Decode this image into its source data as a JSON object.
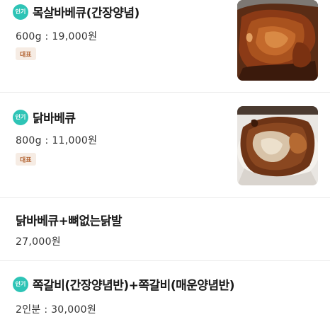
{
  "menu": {
    "items": [
      {
        "badge": "인기",
        "name": "목살바베큐(간장양념)",
        "price": "600g : 19,000원",
        "tag": "대표",
        "image": "grilled-pork-neck-photo"
      },
      {
        "badge": "인기",
        "name": "닭바베큐",
        "price": "800g : 11,000원",
        "tag": "대표",
        "image": "grilled-chicken-photo"
      },
      {
        "name": "닭바베큐+뼈없는닭발",
        "price": "27,000원"
      },
      {
        "badge": "인기",
        "name": "쪽갈비(간장양념반)+쪽갈비(매운양념반)",
        "price": "2인분 : 30,000원"
      }
    ]
  },
  "colors": {
    "popular_badge": "#2ec4b6",
    "rep_tag_bg": "#f6ece4",
    "rep_tag_text": "#b2612f"
  }
}
